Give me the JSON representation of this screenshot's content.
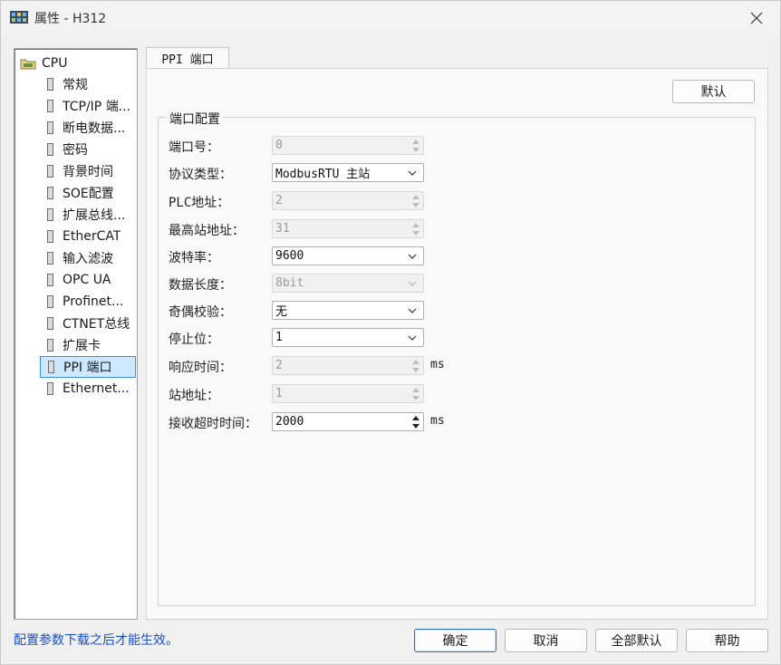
{
  "window": {
    "title": "属性 - H312"
  },
  "tree": {
    "root": "CPU",
    "items": [
      {
        "label": "常规"
      },
      {
        "label": "TCP/IP 端..."
      },
      {
        "label": "断电数据..."
      },
      {
        "label": "密码"
      },
      {
        "label": "背景时间"
      },
      {
        "label": "SOE配置"
      },
      {
        "label": "扩展总线..."
      },
      {
        "label": "EtherCAT"
      },
      {
        "label": "输入滤波"
      },
      {
        "label": "OPC UA"
      },
      {
        "label": "Profinet..."
      },
      {
        "label": "CTNET总线"
      },
      {
        "label": "扩展卡"
      },
      {
        "label": "PPI 端口",
        "selected": true
      },
      {
        "label": "Ethernet..."
      }
    ]
  },
  "tab": {
    "label": "PPI 端口"
  },
  "panel": {
    "default_button": "默认",
    "group_title": "端口配置",
    "fields": [
      {
        "label": "端口号：",
        "value": "0",
        "kind": "spin",
        "enabled": false,
        "unit": ""
      },
      {
        "label": "协议类型：",
        "value": "ModbusRTU 主站",
        "kind": "combo",
        "enabled": true,
        "unit": ""
      },
      {
        "label": "PLC地址：",
        "value": "2",
        "kind": "spin",
        "enabled": false,
        "unit": ""
      },
      {
        "label": "最高站地址：",
        "value": "31",
        "kind": "spin",
        "enabled": false,
        "unit": ""
      },
      {
        "label": "波特率：",
        "value": "9600",
        "kind": "combo",
        "enabled": true,
        "unit": ""
      },
      {
        "label": "数据长度：",
        "value": "8bit",
        "kind": "combo",
        "enabled": false,
        "unit": ""
      },
      {
        "label": "奇偶校验：",
        "value": "无",
        "kind": "combo",
        "enabled": true,
        "unit": ""
      },
      {
        "label": "停止位：",
        "value": "1",
        "kind": "combo",
        "enabled": true,
        "unit": ""
      },
      {
        "label": "响应时间：",
        "value": "2",
        "kind": "spin",
        "enabled": false,
        "unit": "ms"
      },
      {
        "label": "站地址：",
        "value": "1",
        "kind": "spin",
        "enabled": false,
        "unit": ""
      },
      {
        "label": "接收超时时间：",
        "value": "2000",
        "kind": "spin",
        "enabled": true,
        "unit": "ms"
      }
    ]
  },
  "footer": {
    "note": "配置参数下载之后才能生效。",
    "ok": "确定",
    "cancel": "取消",
    "all_default": "全部默认",
    "help": "帮助"
  },
  "colors": {
    "accent": "#3d8ee6",
    "note_text": "#1a4fcc",
    "selection_bg": "#cde8ff"
  }
}
